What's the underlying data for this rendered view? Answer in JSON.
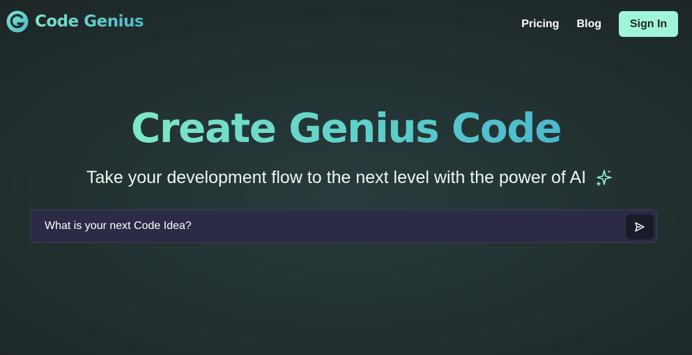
{
  "brand": {
    "name": "Code Genius",
    "icon": "code-genius-logo-icon"
  },
  "nav": {
    "links": [
      "Pricing",
      "Blog"
    ],
    "signin_label": "Sign In"
  },
  "hero": {
    "title": "Create Genius Code",
    "subtitle": "Take your development flow to the next level with the power of AI",
    "subtitle_icon": "sparkle-icon"
  },
  "prompt": {
    "placeholder": "What is your next Code Idea?",
    "value": "",
    "send_icon": "send-icon"
  },
  "colors": {
    "accent": "#9ff5d9",
    "gradient_start": "#7ee8c8",
    "gradient_end": "#4bb8cc",
    "input_bg": "#2c2b46",
    "send_bg": "#181b28"
  }
}
